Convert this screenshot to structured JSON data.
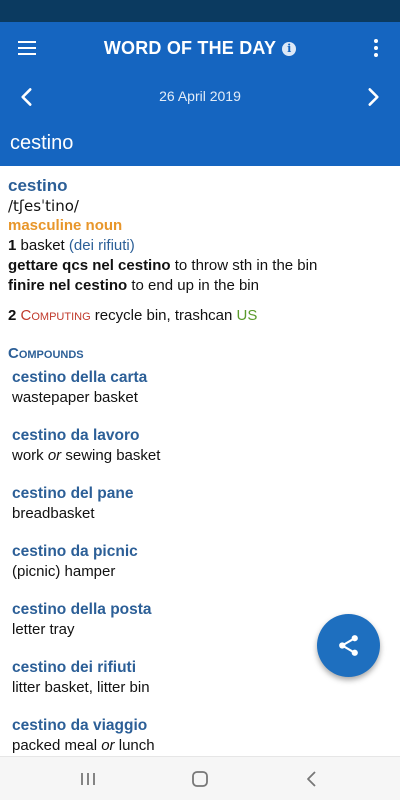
{
  "app_bar": {
    "title": "WORD OF THE DAY",
    "date": "26 April 2019",
    "headword": "cestino",
    "background": "#1565c0",
    "icons": [
      "menu-icon",
      "info-icon",
      "more-vert-icon",
      "chevron-left-icon",
      "chevron-right-icon"
    ]
  },
  "entry": {
    "headword": "cestino",
    "pronunciation": "/tʃesˈtino/",
    "part_of_speech": "masculine noun",
    "sense1": {
      "number": "1",
      "translation": "basket",
      "gloss": "(dei rifiuti)",
      "examples": [
        {
          "phrase": "gettare qcs nel cestino",
          "translation": "to throw sth in the bin"
        },
        {
          "phrase": "finire nel cestino",
          "translation": "to end up in the bin"
        }
      ]
    },
    "sense2": {
      "number": "2",
      "domain": "Computing",
      "translation": "recycle bin, trashcan",
      "region": "US"
    },
    "compounds_heading": "Compounds",
    "compounds": [
      {
        "word": "cestino della carta",
        "parts": [
          "wastepaper basket"
        ]
      },
      {
        "word": "cestino da lavoro",
        "parts": [
          "work ",
          "or",
          " sewing basket"
        ]
      },
      {
        "word": "cestino del pane",
        "parts": [
          "breadbasket"
        ]
      },
      {
        "word": "cestino da picnic",
        "parts": [
          "(picnic) hamper"
        ]
      },
      {
        "word": "cestino della posta",
        "parts": [
          "letter tray"
        ]
      },
      {
        "word": "cestino dei rifiuti",
        "parts": [
          "litter basket, litter bin"
        ]
      },
      {
        "word": "cestino da viaggio",
        "parts": [
          "packed meal ",
          "or",
          " lunch"
        ]
      }
    ]
  },
  "fab": {
    "icon": "share-icon",
    "color": "#1e6fbf"
  },
  "system_nav": {
    "icons": [
      "recents-icon",
      "home-icon",
      "back-icon"
    ]
  }
}
